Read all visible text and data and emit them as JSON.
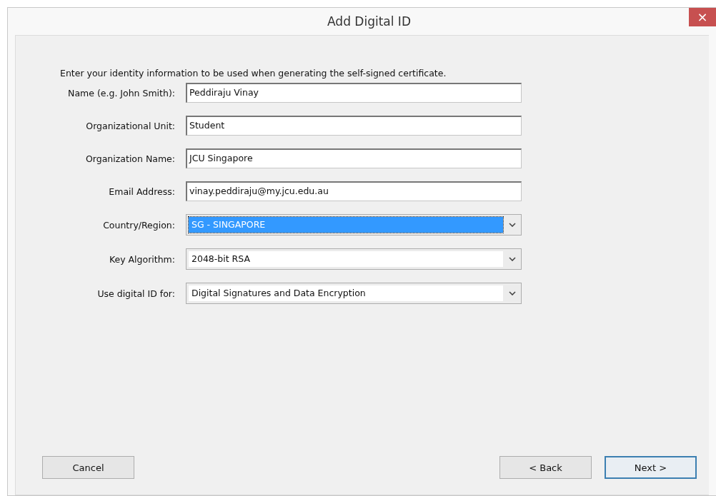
{
  "window": {
    "title": "Add Digital ID",
    "close_glyph": "×"
  },
  "intro": "Enter your identity information to be used when generating the self-signed certificate.",
  "fields": [
    {
      "kind": "text",
      "label": "Name (e.g. John Smith):",
      "value": "Peddiraju Vinay"
    },
    {
      "kind": "text",
      "label": "Organizational Unit:",
      "value": "Student"
    },
    {
      "kind": "text",
      "label": "Organization Name:",
      "value": "JCU Singapore"
    },
    {
      "kind": "text",
      "label": "Email Address:",
      "value": "vinay.peddiraju@my.jcu.edu.au"
    },
    {
      "kind": "dropdown",
      "label": "Country/Region:",
      "value": "SG - SINGAPORE",
      "focused": true
    },
    {
      "kind": "dropdown",
      "label": "Key Algorithm:",
      "value": "2048-bit RSA",
      "focused": false
    },
    {
      "kind": "dropdown",
      "label": "Use digital ID for:",
      "value": "Digital Signatures and Data Encryption",
      "focused": false
    }
  ],
  "buttons": [
    {
      "label": "Cancel",
      "default": false
    },
    {
      "label": "< Back",
      "default": false
    },
    {
      "label": "Next >",
      "default": true
    }
  ]
}
